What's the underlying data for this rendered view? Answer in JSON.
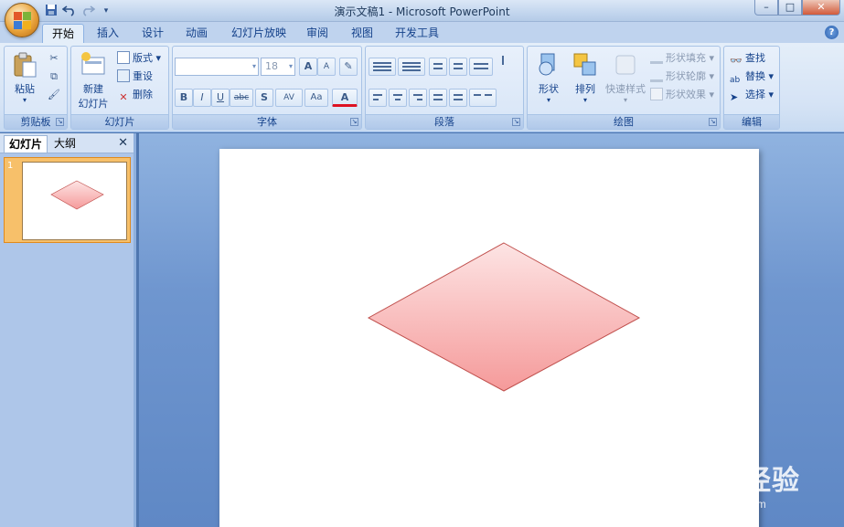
{
  "window": {
    "title": "演示文稿1 - Microsoft PowerPoint",
    "minimize": "–",
    "maximize": "□",
    "close": "✕"
  },
  "quick_access": [
    "save-icon",
    "undo-icon",
    "redo-icon",
    "customize-icon"
  ],
  "tabs": [
    {
      "label": "开始",
      "active": true
    },
    {
      "label": "插入"
    },
    {
      "label": "设计"
    },
    {
      "label": "动画"
    },
    {
      "label": "幻灯片放映"
    },
    {
      "label": "审阅"
    },
    {
      "label": "视图"
    },
    {
      "label": "开发工具"
    }
  ],
  "help_label": "?",
  "ribbon": {
    "clipboard": {
      "label": "剪贴板",
      "paste": "粘贴"
    },
    "slides": {
      "label": "幻灯片",
      "new_slide_line1": "新建",
      "new_slide_line2": "幻灯片",
      "layout": "版式",
      "reset": "重设",
      "delete": "删除"
    },
    "font": {
      "label": "字体",
      "font_name": "",
      "font_size": "18",
      "grow": "A",
      "shrink": "A",
      "bold": "B",
      "italic": "I",
      "underline": "U",
      "strike": "abc",
      "shadow": "S",
      "spacing": "AV",
      "case": "Aa",
      "color": "A"
    },
    "paragraph": {
      "label": "段落"
    },
    "drawing": {
      "label": "绘图",
      "shapes": "形状",
      "arrange": "排列",
      "quick_styles": "快速样式",
      "fill": "形状填充",
      "outline": "形状轮廓",
      "effects": "形状效果"
    },
    "editing": {
      "label": "编辑",
      "find": "查找",
      "replace": "替换",
      "select": "选择"
    }
  },
  "pane": {
    "tab_slides": "幻灯片",
    "tab_outline": "大纲",
    "close": "✕",
    "slide_number": "1"
  },
  "slide": {
    "shape": "diamond",
    "fill_top": "#fde4e4",
    "fill_bottom": "#f59a9a",
    "stroke": "#c0504d"
  },
  "watermark": {
    "main": "Bai du 经验",
    "sub": "jingyan.baidu.com"
  }
}
